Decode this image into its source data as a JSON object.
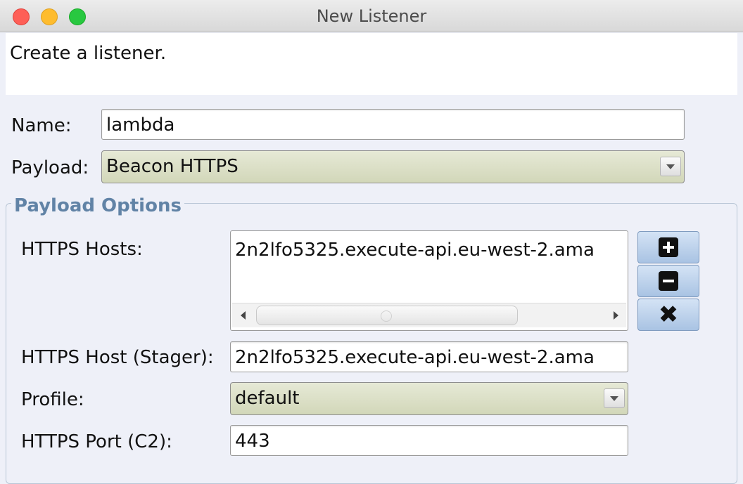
{
  "window": {
    "title": "New Listener"
  },
  "banner": {
    "text": "Create a listener."
  },
  "form": {
    "name_label": "Name:",
    "name_value": "lambda",
    "payload_label": "Payload:",
    "payload_value": "Beacon HTTPS"
  },
  "payload_options": {
    "title": "Payload Options",
    "https_hosts_label": "HTTPS Hosts:",
    "https_hosts": [
      "2n2lfo5325.execute-api.eu-west-2.ama"
    ],
    "stager_label": "HTTPS Host (Stager):",
    "stager_value": "2n2lfo5325.execute-api.eu-west-2.ama",
    "profile_label": "Profile:",
    "profile_value": "default",
    "port_label": "HTTPS Port (C2):",
    "port_value": "443"
  },
  "icons": {
    "add": "plus-icon",
    "remove": "minus-icon",
    "clear": "x-icon",
    "dropdown": "chevron-down-icon"
  },
  "colors": {
    "group_title": "#6183a6",
    "combo_bg": "#d2d7b9",
    "close_light": "#fe5f57",
    "min_light": "#febc2e",
    "max_light": "#28c840"
  }
}
